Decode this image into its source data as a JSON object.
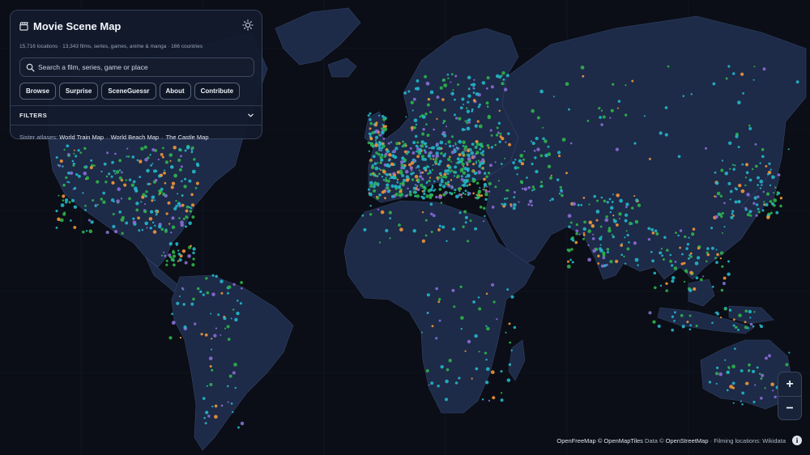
{
  "app": {
    "title": "Movie Scene Map",
    "stats": "15,716 locations · 13,343 films, series, games, anime & manga · 166 countries"
  },
  "search": {
    "placeholder": "Search a film, series, game or place"
  },
  "nav_buttons": [
    "Browse",
    "Surprise",
    "SceneGuessr",
    "About",
    "Contribute"
  ],
  "filters": {
    "label": "FILTERS"
  },
  "sister": {
    "prefix": "Sister atlases:",
    "links": [
      "World Train Map",
      "World Beach Map",
      "The Castle Map"
    ]
  },
  "zoom": {
    "in": "+",
    "out": "−"
  },
  "attribution": {
    "parts": [
      "OpenFreeMap",
      "© OpenMapTiles",
      "Data ©",
      "OpenStreetMap",
      "· Filming locations: Wikidata"
    ]
  },
  "icons": {
    "logo": "clapperboard-icon",
    "theme": "sun-icon",
    "search": "search-icon",
    "filters": "chevron-down-icon",
    "info": "info-icon"
  },
  "colors": {
    "background": "#0b0e16",
    "land": "#1d2a48",
    "marker_cyan": "#23b6c9",
    "marker_green": "#2fb34a",
    "marker_orange": "#f0963a",
    "marker_purple": "#8a6cd6"
  }
}
